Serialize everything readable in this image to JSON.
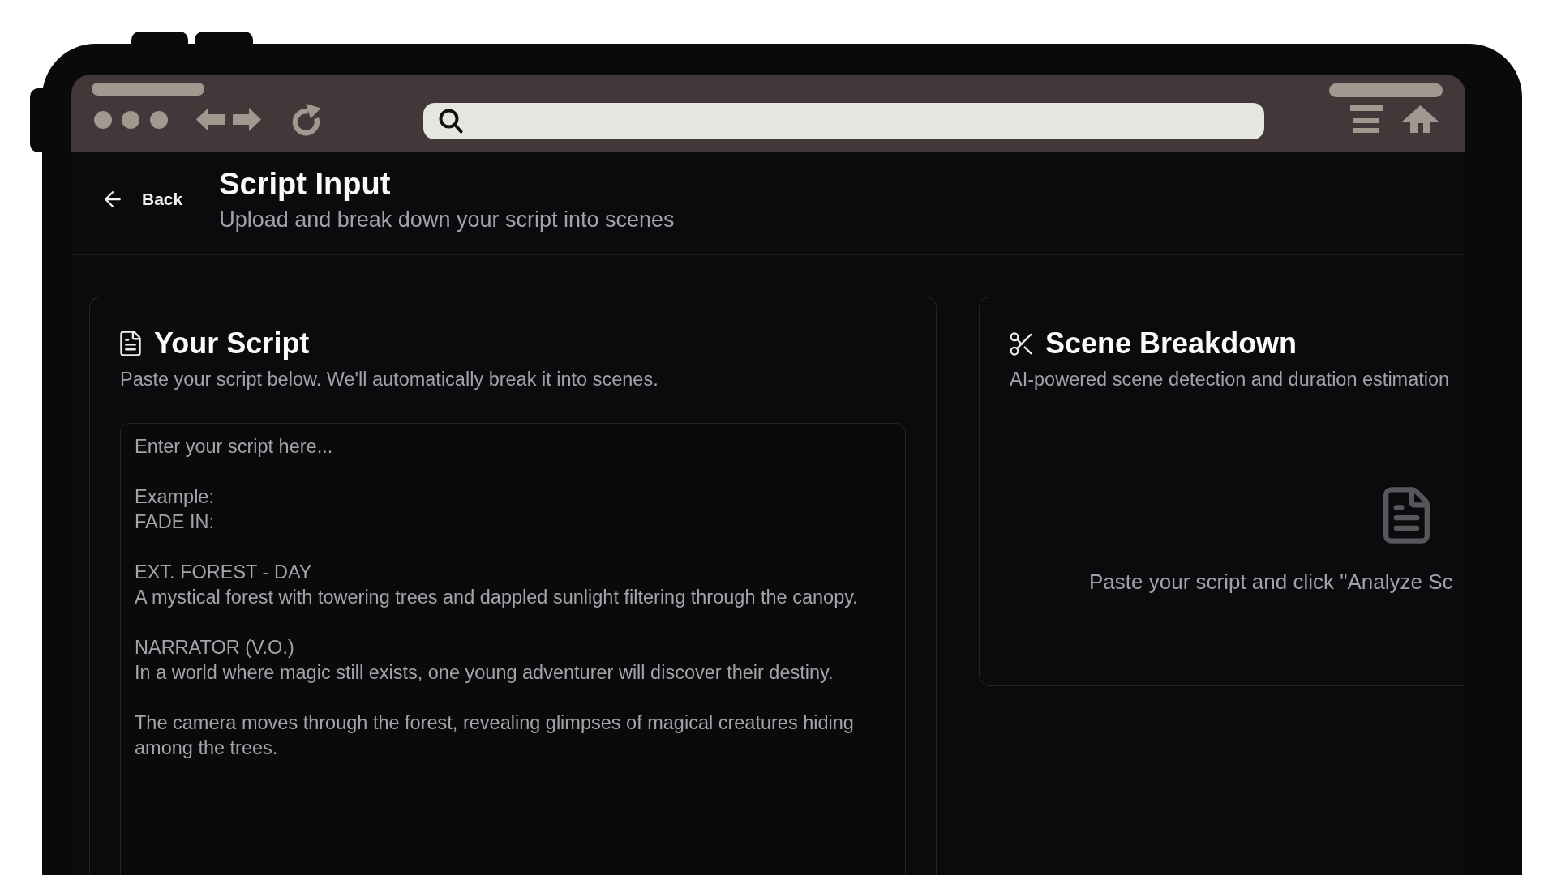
{
  "header": {
    "back_label": "Back",
    "title": "Script Input",
    "subtitle": "Upload and break down your script into scenes"
  },
  "script_panel": {
    "title": "Your Script",
    "description": "Paste your script below. We'll automatically break it into scenes.",
    "editor": {
      "placeholder": "Enter your script here...\n\nExample:\nFADE IN:\n\nEXT. FOREST - DAY\nA mystical forest with towering trees and dappled sunlight filtering through the canopy.\n\nNARRATOR (V.O.)\nIn a world where magic still exists, one young adventurer will discover their destiny.\n\nThe camera moves through the forest, revealing glimpses of magical creatures hiding among the trees."
    }
  },
  "breakdown_panel": {
    "title": "Scene Breakdown",
    "description": "AI-powered scene detection and duration estimation",
    "empty_state": {
      "message": "Paste your script and click \"Analyze Sc"
    }
  }
}
